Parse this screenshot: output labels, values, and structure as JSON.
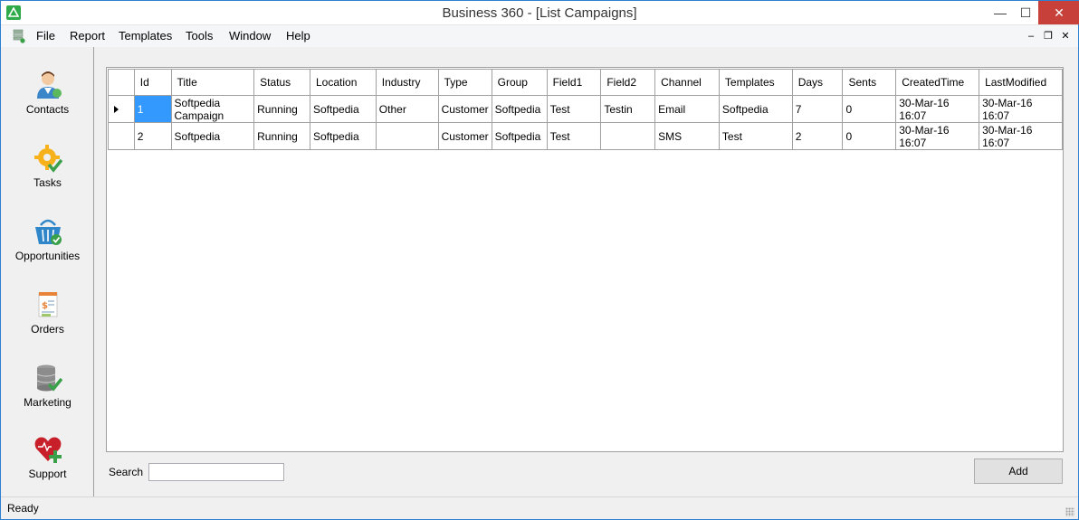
{
  "window": {
    "title": "Business 360 - [List Campaigns]",
    "minimize": "—",
    "maximize": "☐",
    "close": "✕"
  },
  "menu": {
    "items": [
      "File",
      "Report",
      "Templates",
      "Tools",
      "Window",
      "Help"
    ],
    "mdi_minimize": "–",
    "mdi_restore": "❐",
    "mdi_close": "✕"
  },
  "sidebar": {
    "items": [
      {
        "label": "Contacts",
        "icon": "contacts-icon"
      },
      {
        "label": "Tasks",
        "icon": "tasks-icon"
      },
      {
        "label": "Opportunities",
        "icon": "opportunities-icon"
      },
      {
        "label": "Orders",
        "icon": "orders-icon"
      },
      {
        "label": "Marketing",
        "icon": "marketing-icon"
      },
      {
        "label": "Support",
        "icon": "support-icon"
      }
    ]
  },
  "grid": {
    "columns": [
      "Id",
      "Title",
      "Status",
      "Location",
      "Industry",
      "Type",
      "Group",
      "Field1",
      "Field2",
      "Channel",
      "Templates",
      "Days",
      "Sents",
      "CreatedTime",
      "LastModified"
    ],
    "rows": [
      [
        "1",
        "Softpedia Campaign",
        "Running",
        "Softpedia",
        "Other",
        "Customer",
        "Softpedia",
        "Test",
        "Testin",
        "Email",
        "Softpedia",
        "7",
        "0",
        "30-Mar-16 16:07",
        "30-Mar-16 16:07"
      ],
      [
        "2",
        "Softpedia",
        "Running",
        "Softpedia",
        "",
        "Customer",
        "Softpedia",
        "Test",
        "",
        "SMS",
        "Test",
        "2",
        "0",
        "30-Mar-16 16:07",
        "30-Mar-16 16:07"
      ]
    ]
  },
  "search": {
    "label": "Search",
    "value": ""
  },
  "add_button": "Add",
  "status": "Ready",
  "colors": {
    "selection": "#3399ff",
    "close_button": "#c7403a",
    "app_icon": "#2faa4a"
  }
}
